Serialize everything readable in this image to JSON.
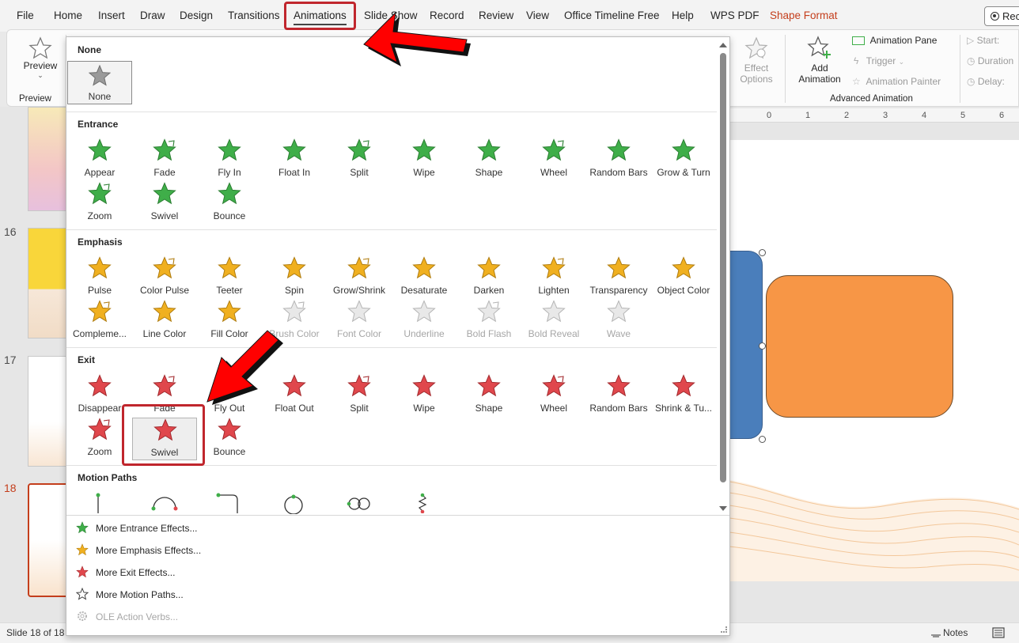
{
  "menu": {
    "items": [
      "File",
      "Home",
      "Insert",
      "Draw",
      "Design",
      "Transitions",
      "Animations",
      "Slide Show",
      "Record",
      "Review",
      "View",
      "Office Timeline Free",
      "Help",
      "WPS PDF",
      "Shape Format"
    ],
    "active": "Animations",
    "record_label": "Rec"
  },
  "ribbon": {
    "preview_label": "Preview",
    "preview_group": "Preview",
    "effect_options_line1": "Effect",
    "effect_options_line2": "Options",
    "add_animation_line1": "Add",
    "add_animation_line2": "Animation",
    "animation_pane": "Animation Pane",
    "trigger": "Trigger",
    "animation_painter": "Animation Painter",
    "advanced_group": "Advanced Animation",
    "start": "Start:",
    "duration": "Duration",
    "delay": "Delay:"
  },
  "slides": {
    "numbers": [
      "16",
      "17",
      "18"
    ],
    "current": "18"
  },
  "ruler": [
    "0",
    "1",
    "2",
    "3",
    "4",
    "5",
    "6"
  ],
  "gallery": {
    "none_section": "None",
    "none_item": "None",
    "entrance_section": "Entrance",
    "entrance": [
      "Appear",
      "Fade",
      "Fly In",
      "Float In",
      "Split",
      "Wipe",
      "Shape",
      "Wheel",
      "Random Bars",
      "Grow & Turn",
      "Zoom",
      "Swivel",
      "Bounce"
    ],
    "emphasis_section": "Emphasis",
    "emphasis": [
      "Pulse",
      "Color Pulse",
      "Teeter",
      "Spin",
      "Grow/Shrink",
      "Desaturate",
      "Darken",
      "Lighten",
      "Transparency",
      "Object Color",
      "Compleme...",
      "Line Color",
      "Fill Color",
      "Brush Color",
      "Font Color",
      "Underline",
      "Bold Flash",
      "Bold Reveal",
      "Wave"
    ],
    "exit_section": "Exit",
    "exit": [
      "Disappear",
      "Fade",
      "Fly Out",
      "Float Out",
      "Split",
      "Wipe",
      "Shape",
      "Wheel",
      "Random Bars",
      "Shrink & Tu...",
      "Zoom",
      "Swivel",
      "Bounce"
    ],
    "exit_selected": "Swivel",
    "motion_section": "Motion Paths",
    "more": [
      "More Entrance Effects...",
      "More Emphasis Effects...",
      "More Exit Effects...",
      "More Motion Paths...",
      "OLE Action Verbs..."
    ]
  },
  "status": {
    "slide_info": "Slide 18 of 18",
    "notes": "Notes"
  },
  "colors": {
    "entrance": "#3fae49",
    "emphasis": "#f0b020",
    "exit": "#e0474c",
    "accent": "#c43e1c",
    "highlight": "#c0262d"
  }
}
